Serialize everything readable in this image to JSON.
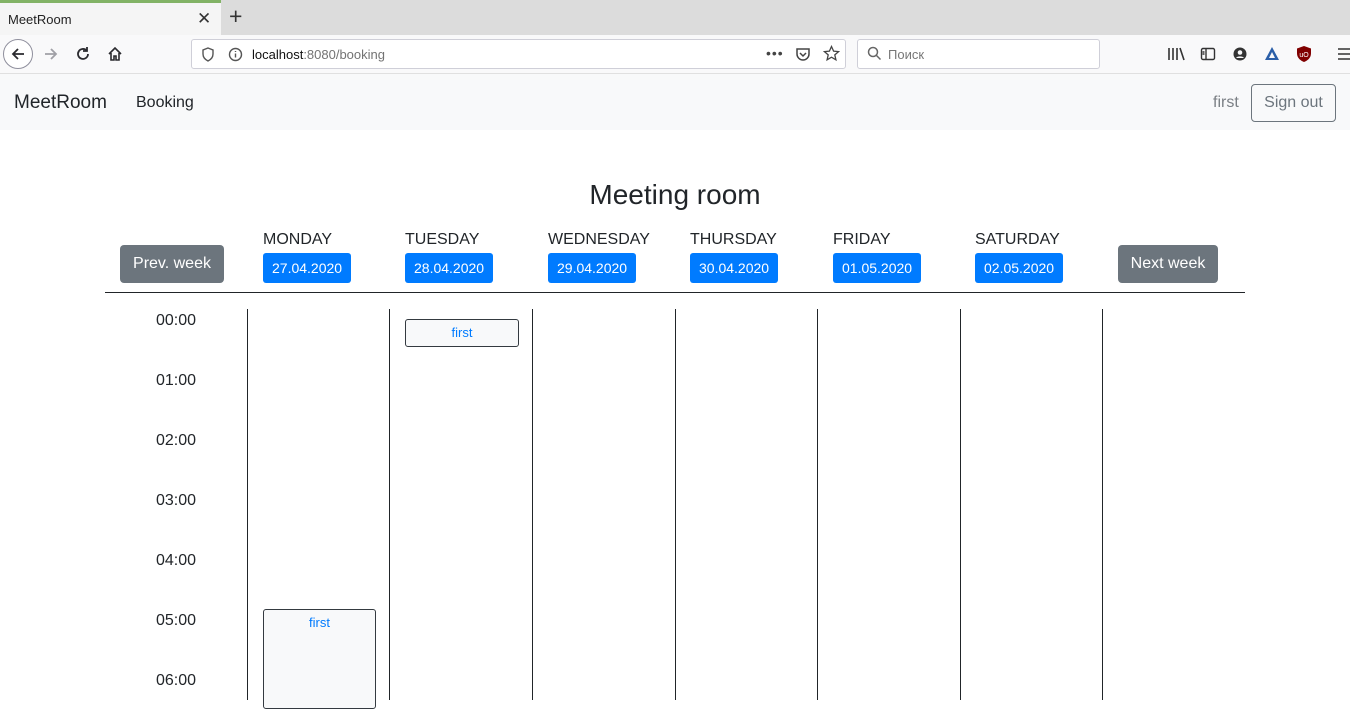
{
  "browser": {
    "tab_title": "MeetRoom",
    "tab_close": "✕",
    "new_tab": "+",
    "url_host": "localhost",
    "url_rest": ":8080/booking",
    "search_placeholder": "Поиск"
  },
  "app": {
    "brand": "MeetRoom",
    "nav_booking": "Booking",
    "user": "first",
    "sign_out": "Sign out"
  },
  "booking": {
    "title": "Meeting room",
    "prev_week": "Prev. week",
    "next_week": "Next week",
    "days": [
      {
        "name": "Monday",
        "date": "27.04.2020"
      },
      {
        "name": "Tuesday",
        "date": "28.04.2020"
      },
      {
        "name": "Wednesday",
        "date": "29.04.2020"
      },
      {
        "name": "Thursday",
        "date": "30.04.2020"
      },
      {
        "name": "Friday",
        "date": "01.05.2020"
      },
      {
        "name": "Saturday",
        "date": "02.05.2020"
      }
    ],
    "times": [
      "00:00",
      "01:00",
      "02:00",
      "03:00",
      "04:00",
      "05:00",
      "06:00"
    ],
    "events": [
      {
        "label": "first",
        "day": "Tuesday",
        "start": "00:00"
      },
      {
        "label": "first",
        "day": "Monday",
        "start": "05:00"
      }
    ]
  }
}
